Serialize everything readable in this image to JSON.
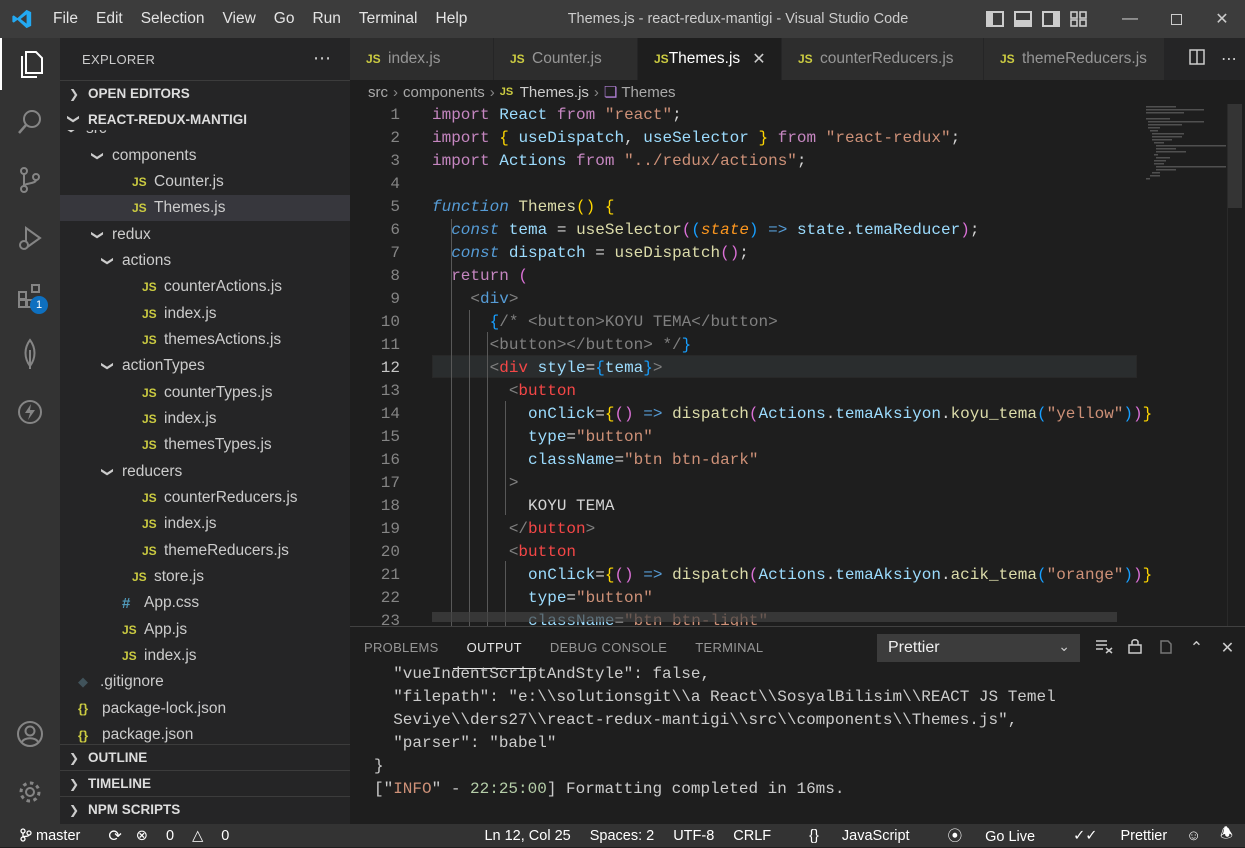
{
  "window": {
    "title": "Themes.js - react-redux-mantigi - Visual Studio Code"
  },
  "menu": [
    "File",
    "Edit",
    "Selection",
    "View",
    "Go",
    "Run",
    "Terminal",
    "Help"
  ],
  "activity": {
    "extensions_badge": "1"
  },
  "sidebar": {
    "title": "EXPLORER",
    "open_editors": "OPEN EDITORS",
    "project": "REACT-REDUX-MANTIGI",
    "tree": [
      {
        "label": "src",
        "icon": "folder",
        "depth": 0
      },
      {
        "label": "components",
        "icon": "folder",
        "depth": 1
      },
      {
        "label": "Counter.js",
        "icon": "js",
        "depth": 2
      },
      {
        "label": "Themes.js",
        "icon": "js",
        "depth": 2,
        "selected": true
      },
      {
        "label": "redux",
        "icon": "folder",
        "depth": 1
      },
      {
        "label": "actions",
        "icon": "folder",
        "depth": 2
      },
      {
        "label": "counterActions.js",
        "icon": "js",
        "depth": 3
      },
      {
        "label": "index.js",
        "icon": "js",
        "depth": 3
      },
      {
        "label": "themesActions.js",
        "icon": "js",
        "depth": 3
      },
      {
        "label": "actionTypes",
        "icon": "folder",
        "depth": 2
      },
      {
        "label": "counterTypes.js",
        "icon": "js",
        "depth": 3
      },
      {
        "label": "index.js",
        "icon": "js",
        "depth": 3
      },
      {
        "label": "themesTypes.js",
        "icon": "js",
        "depth": 3
      },
      {
        "label": "reducers",
        "icon": "folder",
        "depth": 2
      },
      {
        "label": "counterReducers.js",
        "icon": "js",
        "depth": 3
      },
      {
        "label": "index.js",
        "icon": "js",
        "depth": 3
      },
      {
        "label": "themeReducers.js",
        "icon": "js",
        "depth": 3
      },
      {
        "label": "store.js",
        "icon": "js",
        "depth": 2
      },
      {
        "label": "App.css",
        "icon": "css",
        "depth": 1
      },
      {
        "label": "App.js",
        "icon": "js",
        "depth": 1
      },
      {
        "label": "index.js",
        "icon": "js",
        "depth": 1
      },
      {
        "label": ".gitignore",
        "icon": "git",
        "depth": 0
      },
      {
        "label": "package-lock.json",
        "icon": "json",
        "depth": 0
      },
      {
        "label": "package.json",
        "icon": "json",
        "depth": 0
      }
    ],
    "outline": "OUTLINE",
    "timeline": "TIMELINE",
    "npm_scripts": "NPM SCRIPTS"
  },
  "tabs": [
    {
      "label": "index.js",
      "active": false
    },
    {
      "label": "Counter.js",
      "active": false
    },
    {
      "label": "Themes.js",
      "active": true
    },
    {
      "label": "counterReducers.js",
      "active": false
    },
    {
      "label": "themeReducers.js",
      "active": false
    }
  ],
  "breadcrumb": {
    "src": "src",
    "components": "components",
    "file": "Themes.js",
    "symbol": "Themes"
  },
  "editor": {
    "current_line": 12,
    "line_count": 23
  },
  "panel": {
    "tabs": [
      "PROBLEMS",
      "OUTPUT",
      "DEBUG CONSOLE",
      "TERMINAL"
    ],
    "active_tab": "OUTPUT",
    "channel": "Prettier",
    "lines": [
      "  \"vueIndentScriptAndStyle\": false,",
      "  \"filepath\": \"e:\\\\solutionsgit\\\\a React\\\\SosyalBilisim\\\\REACT JS Temel",
      "  Seviye\\\\ders27\\\\react-redux-mantigi\\\\src\\\\components\\\\Themes.js\",",
      "  \"parser\": \"babel\"",
      "}"
    ],
    "info_prefix": "[\"",
    "info_word": "INFO",
    "info_mid": "\" - ",
    "info_time": "22:25:00",
    "info_msg": "] Formatting completed in 16ms."
  },
  "status": {
    "branch": "master",
    "errors": "0",
    "warnings": "0",
    "position": "Ln 12, Col 25",
    "spaces": "Spaces: 2",
    "encoding": "UTF-8",
    "eol": "CRLF",
    "language": "JavaScript",
    "golive": "Go Live",
    "prettier": "Prettier"
  }
}
